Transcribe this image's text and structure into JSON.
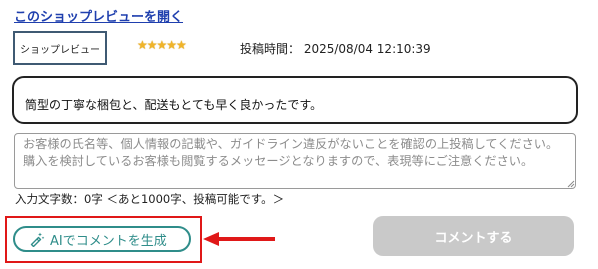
{
  "header": {
    "open_review_link": "このショップレビューを開く"
  },
  "review": {
    "tag_label": "ショップレビュー",
    "stars": "★★★★★",
    "rating": 5,
    "rating_max": 5,
    "star_color": "#f0b429",
    "post_time": "投稿時間： 2025/08/04 12:10:39",
    "body": "筒型の丁寧な梱包と、配送もとても早く良かったです。"
  },
  "comment": {
    "value": "",
    "placeholder": "お客様の氏名等、個人情報の記載や、ガイドライン違反がないことを確認の上投稿してください。購入を検討しているお客様も閲覧するメッセージとなりますので、表現等にご注意ください。",
    "char_count": "入力文字数：0字 ＜あと1000字、投稿可能です。＞"
  },
  "actions": {
    "ai_generate_label": "AIでコメントを生成",
    "ai_icon": "magic-wand-icon",
    "submit_label": "コメントする",
    "submit_disabled": true
  },
  "colors": {
    "link": "#1f3fae",
    "accent_teal": "#2f8d8a",
    "highlight_red": "#e01818",
    "disabled_gray": "#c9c9c9"
  }
}
